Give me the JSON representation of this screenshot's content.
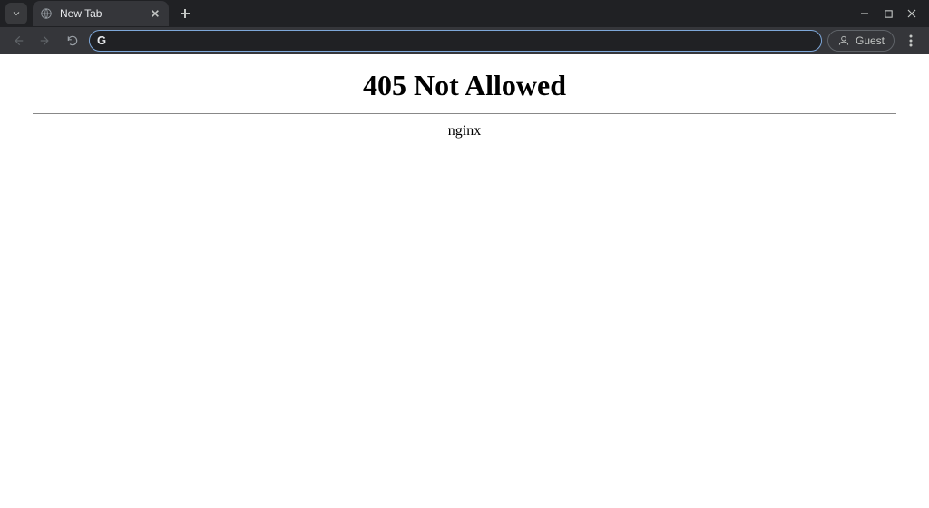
{
  "tab": {
    "title": "New Tab"
  },
  "toolbar": {
    "omnibox_placeholder": "",
    "omnibox_value": "",
    "guest_label": "Guest"
  },
  "page": {
    "heading": "405 Not Allowed",
    "server": "nginx"
  }
}
